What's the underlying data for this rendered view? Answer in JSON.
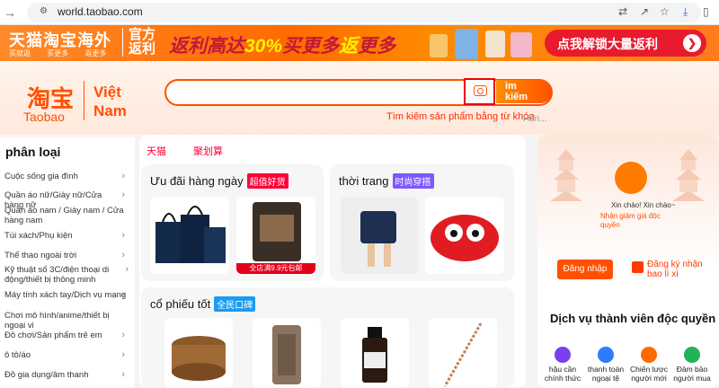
{
  "browser": {
    "url": "world.taobao.com"
  },
  "banner": {
    "brand": "天猫淘宝海外",
    "subs": [
      "买就返",
      "买更多",
      "返更多"
    ],
    "official": "官方返利",
    "promo_a": "返利高达",
    "promo_pct": "30%",
    "promo_b": "买更多",
    "promo_c": "返",
    "promo_d": "更多",
    "cta": "点我解锁大量返利"
  },
  "header": {
    "logo_cn": "淘宝",
    "logo_en": "Taobao",
    "logo_vn_1": "Việt",
    "logo_vn_2": "Nam",
    "search_placeholder": "",
    "search_btn_1": "ìm",
    "search_btn_2": "kiếm",
    "hint": "Tìm kiếm sản phẩm bằng từ khóa",
    "hint_more": "Hđn..."
  },
  "categories": {
    "title": "phân loại",
    "items": [
      "Cuộc sống gia đình",
      "Quần áo nữ/Giày nữ/Cửa hàng nữ",
      "Quần áo nam / Giày nam / Cửa hàng nam",
      "Túi xách/Phụ kiện",
      "Thể thao ngoài trời",
      "Kỹ thuật số 3C/điện thoại di động/thiết bị thông minh",
      "Máy tính xách tay/Dịch vụ mạng",
      "Chơi mô hình/anime/thiết bị ngoại vi",
      "Đồ chơi/Sản phẩm trẻ em",
      "ô tô/áo",
      "Đồ gia dụng/âm thanh"
    ]
  },
  "main": {
    "tmall": "天猫",
    "juhuasuan": "聚划算",
    "deals_title": "Ưu đãi hàng ngày",
    "deals_tag": "超值好货",
    "deals_caption": "全店满9.9元包邮",
    "fashion_title": "thời trang",
    "fashion_tag": "时尚穿搭",
    "stock_title": "cổ phiếu tốt",
    "stock_tag": "全民口碑"
  },
  "right": {
    "greet": "Xin chào! Xin chào~",
    "newuser": "Nhận giảm giá độc quyền",
    "login": "Đăng nhập",
    "register": "Đăng ký nhận bao lì xì",
    "member_title": "Dịch vụ thành viên độc quyền",
    "services": [
      {
        "label": "hậu cần chính thức",
        "color": "#7b3ff2"
      },
      {
        "label": "thanh toán ngoại tệ",
        "color": "#2f7bff"
      },
      {
        "label": "Chiến lược người mới",
        "color": "#ff6a00"
      },
      {
        "label": "Đảm bảo người mua",
        "color": "#22b35a"
      }
    ]
  }
}
